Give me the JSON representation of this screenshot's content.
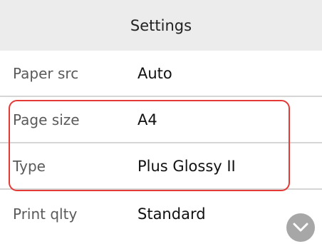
{
  "header": {
    "title": "Settings"
  },
  "settings": [
    {
      "label": "Paper src",
      "value": "Auto"
    },
    {
      "label": "Page size",
      "value": "A4"
    },
    {
      "label": "Type",
      "value": "Plus Glossy II"
    },
    {
      "label": "Print qlty",
      "value": "Standard"
    }
  ],
  "highlight": {
    "color": "#e53935"
  },
  "scroll": {
    "icon": "chevron-down-icon"
  }
}
